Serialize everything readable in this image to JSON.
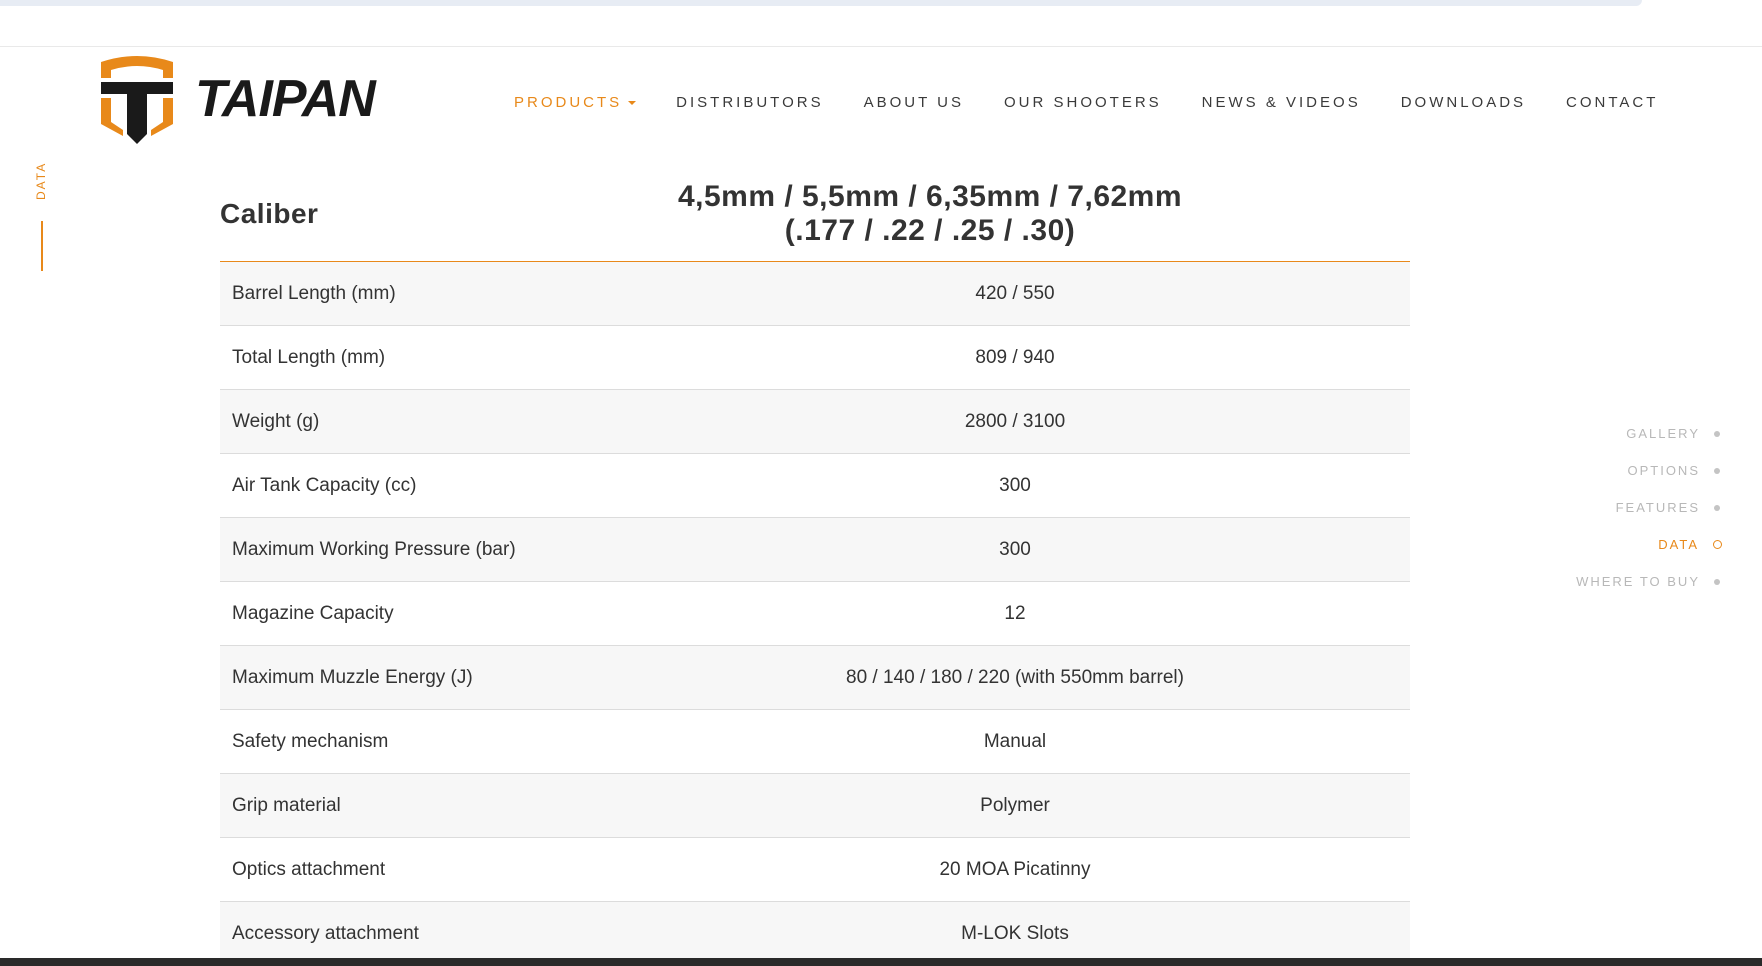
{
  "brand": {
    "name": "TAIPAN",
    "accent": "#e8891a",
    "dark": "#1a1a1a"
  },
  "nav": {
    "items": [
      {
        "label": "PRODUCTS",
        "active": true
      },
      {
        "label": "DISTRIBUTORS"
      },
      {
        "label": "ABOUT US"
      },
      {
        "label": "OUR SHOOTERS"
      },
      {
        "label": "NEWS & VIDEOS"
      },
      {
        "label": "DOWNLOADS"
      },
      {
        "label": "CONTACT"
      }
    ]
  },
  "section_label": "DATA",
  "specs": {
    "header": {
      "label": "Caliber",
      "value_line1": "4,5mm / 5,5mm / 6,35mm / 7,62mm",
      "value_line2": "(.177 / .22 / .25 / .30)"
    },
    "rows": [
      {
        "label": "Barrel Length (mm)",
        "value": "420 / 550"
      },
      {
        "label": "Total Length (mm)",
        "value": "809 / 940"
      },
      {
        "label": "Weight (g)",
        "value": "2800 / 3100"
      },
      {
        "label": "Air Tank Capacity (cc)",
        "value": "300"
      },
      {
        "label": "Maximum Working Pressure (bar)",
        "value": "300"
      },
      {
        "label": "Magazine Capacity",
        "value": "12"
      },
      {
        "label": "Maximum Muzzle Energy (J)",
        "value": "80 / 140 / 180 / 220 (with 550mm barrel)"
      },
      {
        "label": "Safety mechanism",
        "value": "Manual"
      },
      {
        "label": "Grip material",
        "value": "Polymer"
      },
      {
        "label": "Optics attachment",
        "value": "20 MOA Picatinny"
      },
      {
        "label": "Accessory attachment",
        "value": "M-LOK Slots"
      }
    ]
  },
  "side_nav": {
    "items": [
      {
        "label": "GALLERY"
      },
      {
        "label": "OPTIONS"
      },
      {
        "label": "FEATURES"
      },
      {
        "label": "DATA",
        "active": true
      },
      {
        "label": "WHERE TO BUY"
      }
    ]
  }
}
